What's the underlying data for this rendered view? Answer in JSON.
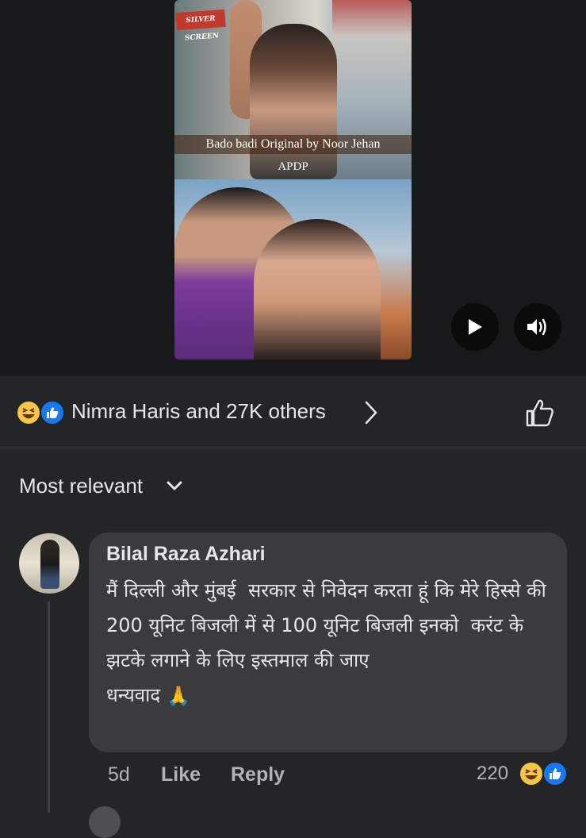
{
  "video": {
    "logo_text": "SILVER SCREEN",
    "overlay_title": "Bado badi Original by Noor Jehan",
    "overlay_sub": "APDP",
    "controls": {
      "play_icon": "play-icon",
      "volume_icon": "volume-icon"
    }
  },
  "reactions": {
    "icons": [
      "haha-icon",
      "like-icon"
    ],
    "summary": "Nimra Haris and 27K others"
  },
  "comments_sort": {
    "label": "Most relevant"
  },
  "comment": {
    "author": "Bilal Raza Azhari",
    "text": "मैं दिल्ली और मुंबई  सरकार से निवेदन करता हूं कि मेरे हिस्से की 200 यूनिट बिजली में से 100 यूनिट बिजली इनको  करंट के झटके लगाने के लिए इस्तमाल की जाए\nधन्यवाद",
    "emoji": "🙏",
    "time": "5d",
    "like_label": "Like",
    "reply_label": "Reply",
    "reaction_count": "220"
  },
  "colors": {
    "background": "#242526",
    "bubble": "#3a3b3c",
    "text": "#e4e6eb",
    "secondary_text": "#b0b3b8",
    "like_blue": "#1877f2",
    "haha_yellow": "#f7c548"
  }
}
